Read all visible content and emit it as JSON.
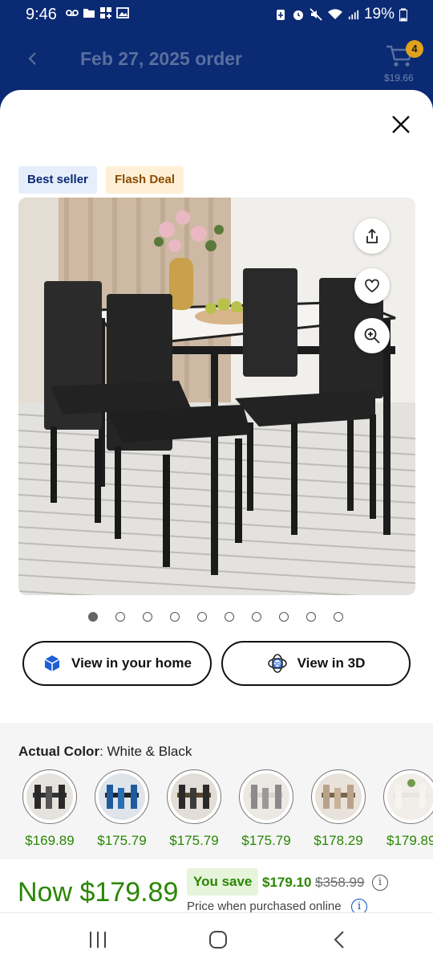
{
  "status_bar": {
    "time": "9:46",
    "battery": "19%"
  },
  "header": {
    "title": "Feb 27, 2025 order",
    "cart_count": "4",
    "cart_total": "$19.66"
  },
  "badges": {
    "best_seller": "Best seller",
    "flash_deal": "Flash Deal"
  },
  "gallery": {
    "image_count": 10,
    "active_index": 0
  },
  "actions": {
    "view_home": "View in your home",
    "view_3d": "View in 3D"
  },
  "color": {
    "label": "Actual Color",
    "value": ": White & Black",
    "options": [
      {
        "price": "$169.89"
      },
      {
        "price": "$175.79"
      },
      {
        "price": "$175.79"
      },
      {
        "price": "$175.79"
      },
      {
        "price": "$178.29"
      },
      {
        "price": "$179.89"
      }
    ]
  },
  "price": {
    "now": "Now $179.89",
    "you_save_label": "You save",
    "save_amount": "$179.10",
    "was": "$358.99",
    "note": "Price when purchased online",
    "info_glyph": "i"
  },
  "colors": {
    "brand_blue": "#0b2a74",
    "price_green": "#2a8703",
    "cart_badge": "#e0a21c"
  }
}
